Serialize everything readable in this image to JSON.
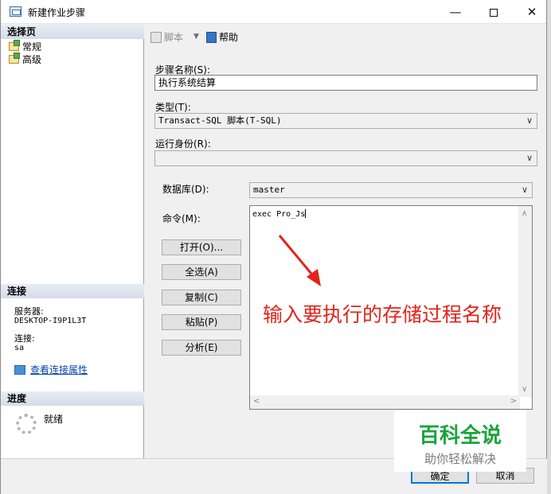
{
  "window": {
    "title": "新建作业步骤",
    "minimize": "—",
    "close": "✕"
  },
  "left": {
    "select_page_header": "选择页",
    "pages": [
      "常规",
      "高级"
    ],
    "connection_header": "连接",
    "server_label": "服务器:",
    "server_value": "DESKTOP-I9P1L3T",
    "conn_label": "连接:",
    "conn_value": "sa",
    "view_conn_link": "查看连接属性",
    "progress_header": "进度",
    "progress_status": "就绪"
  },
  "toolbar": {
    "script_label": "脚本",
    "help_label": "帮助"
  },
  "form": {
    "step_name_label": "步骤名称(S):",
    "step_name_value": "执行系统结算",
    "type_label": "类型(T):",
    "type_value": "Transact-SQL 脚本(T-SQL)",
    "run_as_label": "运行身份(R):",
    "run_as_value": "",
    "database_label": "数据库(D):",
    "database_value": "master",
    "command_label": "命令(M):",
    "command_value": "exec Pro_Js"
  },
  "buttons": {
    "open": "打开(O)...",
    "select_all": "全选(A)",
    "copy": "复制(C)",
    "paste": "粘贴(P)",
    "parse": "分析(E)",
    "ok": "确定",
    "cancel": "取消"
  },
  "annotation": {
    "text": "输入要执行的存储过程名称",
    "color": "#e2231a"
  },
  "watermark": {
    "title": "百科全说",
    "subtitle": "助你轻松解决",
    "color": "#1aa33c"
  }
}
